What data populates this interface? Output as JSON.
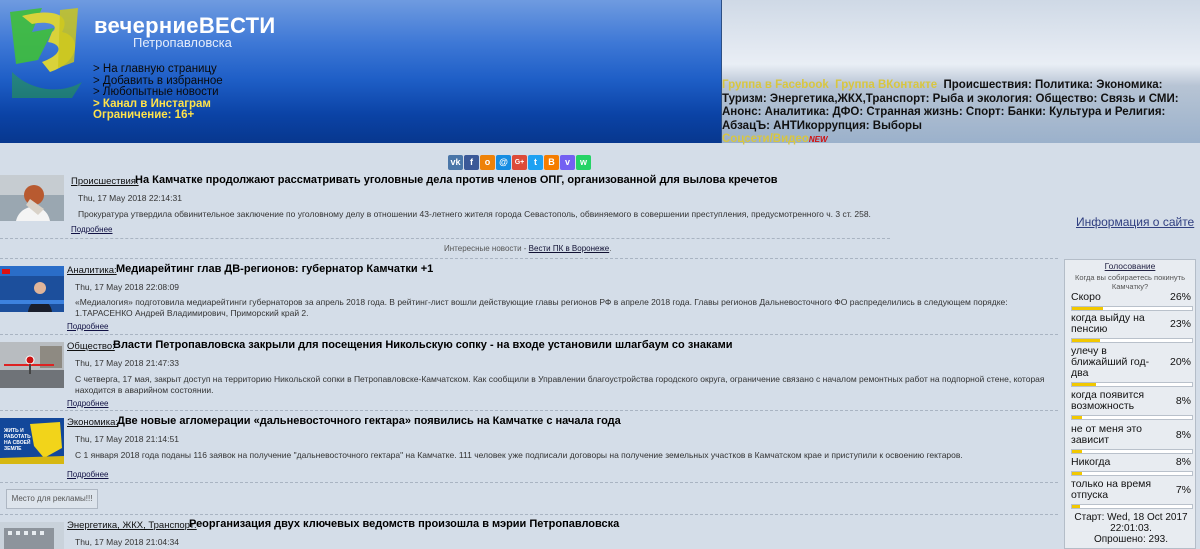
{
  "header": {
    "site_title": "вечерниеВЕСТИ",
    "site_subtitle": "Петропавловска",
    "menu": [
      "> На главную страницу",
      "> Добавить в избранное",
      "> Любопытные новости"
    ],
    "instagram": "> Канал в Инстаграм",
    "age_limit": "Ограничение: 16+",
    "links": {
      "facebook": "Группа в Facebook",
      "vk": "Группа ВКонтакте",
      "rest": "Происшествия: Политика: Экономика: Туризм: Энергетика,ЖКХ,Транспорт: Рыба и экология: Общество: Связь и СМИ: Анонс: Аналитика: ДФО: Странная жизнь: Спорт: Банки: Культура и Религия: АбзацЪ: АНТИкоррупция: Выборы",
      "social": "Соцсети/Видео",
      "new_badge": "NEW"
    }
  },
  "share_icons": [
    {
      "icon": "vk-icon",
      "glyph": "vk",
      "color": "#4a76a8"
    },
    {
      "icon": "facebook-icon",
      "glyph": "f",
      "color": "#3b5998"
    },
    {
      "icon": "odnoklassniki-icon",
      "glyph": "о",
      "color": "#ee8208"
    },
    {
      "icon": "mymail-icon",
      "glyph": "@",
      "color": "#168de2"
    },
    {
      "icon": "googleplus-icon",
      "glyph": "G+",
      "color": "#dd4b39"
    },
    {
      "icon": "twitter-icon",
      "glyph": "t",
      "color": "#1da1f2"
    },
    {
      "icon": "blogger-icon",
      "glyph": "B",
      "color": "#f57d00"
    },
    {
      "icon": "viber-icon",
      "glyph": "v",
      "color": "#7360f2"
    },
    {
      "icon": "whatsapp-icon",
      "glyph": "w",
      "color": "#25d366"
    }
  ],
  "news": [
    {
      "category": "Происшествия:",
      "title": "На Камчатке продолжают рассматривать уголовные дела против членов ОПГ, организованной для вылова кречетов",
      "date": "Thu, 17 May 2018 22:14:31",
      "text": "Прокуратура утвердила обвинительное заключение по уголовному делу в отношении 43-летнего жителя города Севастополь, обвиняемого в совершении преступления, предусмотренного ч. 3 ст. 258.",
      "more": "Подробнее"
    },
    {
      "category": "Аналитика:",
      "title": "Медиарейтинг глав ДВ-регионов: губернатор Камчатки +1",
      "date": "Thu, 17 May 2018 22:08:09",
      "text": "«Медиалогия» подготовила медиарейтинги губернаторов за апрель 2018 года. В рейтинг-лист вошли действующие главы регионов РФ в апреле 2018 года. Главы регионов Дальневосточного ФО распределились в следующем порядке: 1.ТАРАСЕНКО Андрей Владимирович, Приморский край 2.",
      "more": "Подробнее"
    },
    {
      "category": "Общество:",
      "title": "Власти Петропавловска закрыли для посещения Никольскую сопку - на входе установили шлагбаум со знаками",
      "date": "Thu, 17 May 2018 21:47:33",
      "text": "С четверга, 17 мая, закрыт доступ на территорию Никольской сопки в Петропавловске-Камчатском. Как сообщили в Управлении благоустройства городского округа, ограничение связано с началом ремонтных работ на подпорной стене, которая находится в аварийном состоянии.",
      "more": "Подробнее"
    },
    {
      "category": "Экономика:",
      "title": "Две новые агломерации «дальневосточного гектара» появились на Камчатке с начала года",
      "date": "Thu, 17 May 2018 21:14:51",
      "text": "С 1 января 2018 года поданы 116 заявок на получение \"дальневосточного гектара\" на Камчатке. 111 человек уже подписали договоры на получение земельных участков в Камчатском крае и приступили к освоению гектаров.",
      "more": "Подробнее",
      "thumb_text": "ЖИТЬ И РАБОТАТЬ НА СВОЕЙ ЗЕМЛЕ"
    },
    {
      "category": "Энергетика, ЖКХ, Транспорт:",
      "title": "Реорганизация двух ключевых ведомств произошла в мэрии Петропавловска",
      "date": "Thu, 17 May 2018 21:04:34"
    }
  ],
  "interesting": {
    "label": "Интересные новости -",
    "link": "Вести ПК в Воронеже"
  },
  "ad_box": "Место для рекламы!!!",
  "about_link": "Информация о сайте",
  "poll": {
    "title": "Голосование",
    "question": "Когда вы собираетесь покинуть Камчатку?",
    "options": [
      {
        "label": "Скоро",
        "percent": "26%",
        "value": 26
      },
      {
        "label": "когда выйду на пенсию",
        "percent": "23%",
        "value": 23
      },
      {
        "label": "улечу в ближайший год-два",
        "percent": "20%",
        "value": 20
      },
      {
        "label": "когда появится возможность",
        "percent": "8%",
        "value": 8
      },
      {
        "label": "не от меня это зависит",
        "percent": "8%",
        "value": 8
      },
      {
        "label": "Никогда",
        "percent": "8%",
        "value": 8
      },
      {
        "label": "только на время отпуска",
        "percent": "7%",
        "value": 7
      }
    ],
    "start": "Старт: Wed, 18 Oct 2017 22:01:03.",
    "polled": "Опрошено: 293."
  }
}
